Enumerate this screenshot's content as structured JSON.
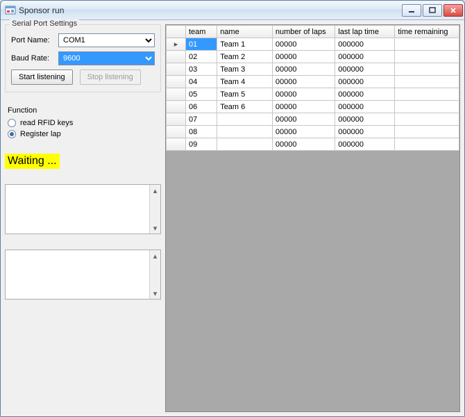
{
  "window": {
    "title": "Sponsor run"
  },
  "serial": {
    "legend": "Serial Port Settings",
    "portLabel": "Port Name:",
    "portValue": "COM1",
    "baudLabel": "Baud Rate:",
    "baudValue": "9600",
    "startBtn": "Start listening",
    "stopBtn": "Stop listening"
  },
  "function": {
    "title": "Function",
    "opt1": "read RFID keys",
    "opt2": "Register lap",
    "selected": "opt2"
  },
  "status": "Waiting ...",
  "grid": {
    "headers": {
      "team": "team",
      "name": "name",
      "laps": "number of laps",
      "last": "last lap time",
      "time": "time remaining"
    },
    "rows": [
      {
        "team": "01",
        "name": "Team 1",
        "laps": "00000",
        "last": "000000",
        "time": ""
      },
      {
        "team": "02",
        "name": "Team 2",
        "laps": "00000",
        "last": "000000",
        "time": ""
      },
      {
        "team": "03",
        "name": "Team 3",
        "laps": "00000",
        "last": "000000",
        "time": ""
      },
      {
        "team": "04",
        "name": "Team 4",
        "laps": "00000",
        "last": "000000",
        "time": ""
      },
      {
        "team": "05",
        "name": "Team 5",
        "laps": "00000",
        "last": "000000",
        "time": ""
      },
      {
        "team": "06",
        "name": "Team 6",
        "laps": "00000",
        "last": "000000",
        "time": ""
      },
      {
        "team": "07",
        "name": "",
        "laps": "00000",
        "last": "000000",
        "time": ""
      },
      {
        "team": "08",
        "name": "",
        "laps": "00000",
        "last": "000000",
        "time": ""
      },
      {
        "team": "09",
        "name": "",
        "laps": "00000",
        "last": "000000",
        "time": ""
      }
    ],
    "currentRow": 0
  }
}
